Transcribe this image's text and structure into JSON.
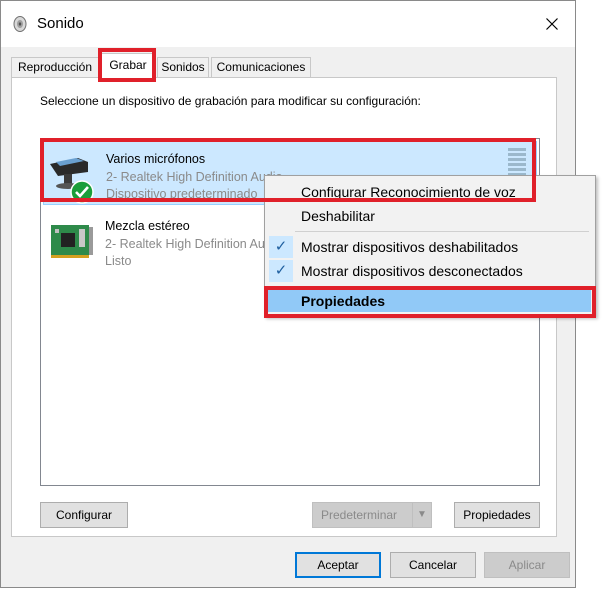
{
  "window": {
    "title": "Sonido",
    "title_icon": "speaker-icon",
    "close_icon": "close-icon"
  },
  "tabs": [
    {
      "label": "Reproducción",
      "active": false
    },
    {
      "label": "Grabar",
      "active": true
    },
    {
      "label": "Sonidos",
      "active": false
    },
    {
      "label": "Comunicaciones",
      "active": false
    }
  ],
  "instruction": "Seleccione un dispositivo de grabación para modificar su configuración:",
  "devices": [
    {
      "name": "Varios micrófonos",
      "driver": "2- Realtek High Definition Audio",
      "status": "Dispositivo predeterminado",
      "icon": "microphone-icon",
      "badge_icon": "default-check-icon",
      "selected": true
    },
    {
      "name": "Mezcla estéreo",
      "driver": "2- Realtek High Definition Audio",
      "status": "Listo",
      "icon": "sound-card-icon",
      "selected": false
    }
  ],
  "context_menu": {
    "items": [
      {
        "label": "Configurar Reconocimiento de voz",
        "checked": false
      },
      {
        "label": "Deshabilitar",
        "checked": false
      },
      {
        "label": "Mostrar dispositivos deshabilitados",
        "checked": true
      },
      {
        "label": "Mostrar dispositivos desconectados",
        "checked": true
      },
      {
        "label": "Propiedades",
        "checked": false,
        "bold": true,
        "highlighted": true
      }
    ]
  },
  "buttons": {
    "configure": "Configurar",
    "set_default": "Predeterminar",
    "properties": "Propiedades",
    "ok": "Aceptar",
    "cancel": "Cancelar",
    "apply": "Aplicar"
  },
  "colors": {
    "annotation": "#e0202a",
    "selection": "#cce8ff",
    "accent": "#0078d7"
  }
}
